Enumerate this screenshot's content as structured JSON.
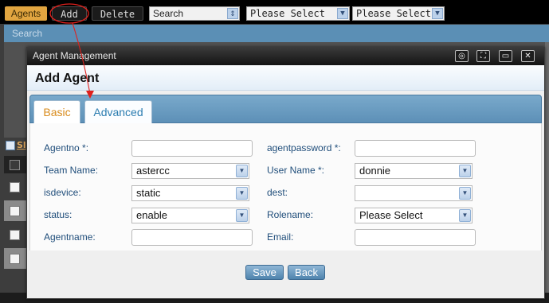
{
  "toolbar": {
    "agents_tab": "Agents",
    "add_label": "Add",
    "delete_label": "Delete",
    "search_select_value": "Search",
    "filter1_value": "Please Select",
    "filter2_value": "Please Select"
  },
  "search_bar": {
    "label": "Search"
  },
  "background": {
    "link_fragment": "Sl"
  },
  "dialog": {
    "title": "Agent Management",
    "heading": "Add Agent",
    "controls": [
      "collapse-icon",
      "maximize-icon",
      "minimize-icon",
      "close-icon"
    ],
    "tabs": [
      {
        "label": "Basic",
        "active": true
      },
      {
        "label": "Advanced",
        "active": false
      }
    ],
    "fields": {
      "agentno": {
        "label": "Agentno *:",
        "value": ""
      },
      "agentpassword": {
        "label": "agentpassword *:",
        "value": ""
      },
      "team_name": {
        "label": "Team Name:",
        "value": "astercc"
      },
      "user_name": {
        "label": "User Name *:",
        "value": "donnie"
      },
      "isdevice": {
        "label": "isdevice:",
        "value": "static"
      },
      "dest": {
        "label": "dest:",
        "value": ""
      },
      "status": {
        "label": "status:",
        "value": "enable"
      },
      "rolename": {
        "label": "Rolename:",
        "value": "Please Select"
      },
      "agentname": {
        "label": "Agentname:",
        "value": ""
      },
      "email": {
        "label": "Email:",
        "value": ""
      }
    },
    "save_label": "Save",
    "back_label": "Back"
  },
  "colors": {
    "accent_orange": "#d88b1c",
    "tab_blue": "#2a7cb0",
    "label_blue": "#1f4d7a",
    "annotation_red": "#e0201c"
  }
}
